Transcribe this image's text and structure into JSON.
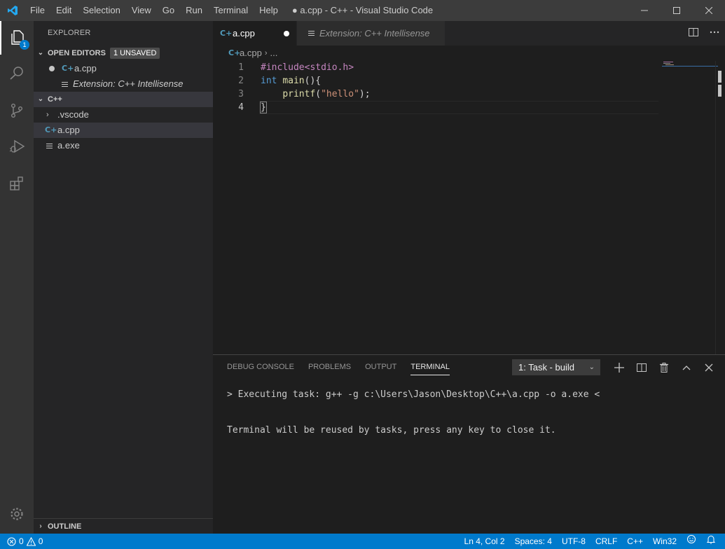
{
  "window": {
    "title": "● a.cpp - C++ - Visual Studio Code",
    "menu": [
      "File",
      "Edit",
      "Selection",
      "View",
      "Go",
      "Run",
      "Terminal",
      "Help"
    ]
  },
  "activity_bar": {
    "explorer_badge": "1"
  },
  "sidebar": {
    "title": "EXPLORER",
    "open_editors": {
      "header": "OPEN EDITORS",
      "badge": "1 UNSAVED",
      "items": [
        {
          "name": "a.cpp",
          "dirty": true
        },
        {
          "name": "Extension: C++ Intellisense",
          "italic": true
        }
      ]
    },
    "folder": {
      "header": "C++",
      "items": [
        {
          "name": ".vscode",
          "type": "folder"
        },
        {
          "name": "a.cpp",
          "type": "cpp",
          "selected": true
        },
        {
          "name": "a.exe",
          "type": "file"
        }
      ]
    },
    "outline_header": "OUTLINE"
  },
  "tabs": [
    {
      "label": "a.cpp",
      "active": true,
      "dirty": true
    },
    {
      "label": "Extension: C++ Intellisense",
      "active": false,
      "italic": true
    }
  ],
  "breadcrumb": {
    "file": "a.cpp",
    "rest": "..."
  },
  "editor": {
    "line_numbers": [
      "1",
      "2",
      "3",
      "4"
    ],
    "lines": {
      "l1_pp": "#include<stdio.h>",
      "l2_kw": "int",
      "l2_fn": "main",
      "l2_rest": "(){",
      "l3_indent": "    ",
      "l3_fn": "printf",
      "l3_open": "(",
      "l3_str": "\"hello\"",
      "l3_close": ");",
      "l4": "}"
    }
  },
  "panel": {
    "tabs": [
      "DEBUG CONSOLE",
      "PROBLEMS",
      "OUTPUT",
      "TERMINAL"
    ],
    "active_tab": "TERMINAL",
    "task_select": "1: Task - build",
    "terminal_lines": [
      "> Executing task: g++ -g c:\\Users\\Jason\\Desktop\\C++\\a.cpp -o a.exe <",
      "Terminal will be reused by tasks, press any key to close it."
    ]
  },
  "statusbar": {
    "errors": "0",
    "warnings": "0",
    "position": "Ln 4, Col 2",
    "spaces": "Spaces: 4",
    "encoding": "UTF-8",
    "eol": "CRLF",
    "language": "C++",
    "platform": "Win32"
  },
  "colors": {
    "accent": "#007acc",
    "titlebar": "#3c3c3c",
    "sidebar": "#252526",
    "editor_bg": "#1e1e1e"
  }
}
